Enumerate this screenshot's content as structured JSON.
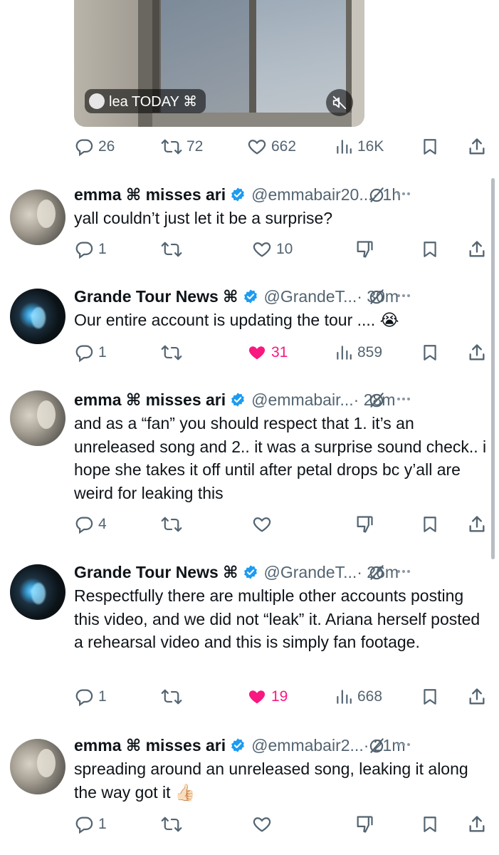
{
  "media": {
    "label": "lea TODAY ⌘"
  },
  "top_actions": {
    "replies": "26",
    "reposts": "72",
    "likes": "662",
    "views": "16K"
  },
  "tweets": [
    {
      "name": "emma ⌘ misses ari",
      "handle": "@emmabair20...",
      "time": "· 1h",
      "text": "yall couldn’t just let it be a surprise?",
      "replies": "1",
      "reposts": "",
      "likes": "10",
      "liked": false,
      "views": ""
    },
    {
      "name": "Grande Tour News ⌘",
      "handle": "@GrandeT...",
      "time": "· 30m",
      "text": "Our entire account is updating the tour .... 😭",
      "replies": "1",
      "reposts": "",
      "likes": "31",
      "liked": true,
      "views": "859"
    },
    {
      "name": "emma ⌘ misses ari",
      "handle": "@emmabair...",
      "time": "· 28m",
      "text": "and as a “fan” you should respect that 1. it’s an unreleased song and 2.. it was a surprise sound check.. i hope she takes it off until after petal drops bc y’all are weird for leaking this",
      "replies": "4",
      "reposts": "",
      "likes": "",
      "liked": false,
      "views": ""
    },
    {
      "name": "Grande Tour News ⌘",
      "handle": "@GrandeT...",
      "time": "· 26m",
      "text": "Respectfully there are multiple other accounts posting this video, and we did not “leak” it. Ariana herself posted a rehearsal video and this is simply fan footage.",
      "replies": "1",
      "reposts": "",
      "likes": "19",
      "liked": true,
      "views": "668"
    },
    {
      "name": "emma ⌘ misses ari",
      "handle": "@emmabair2...",
      "time": "· 21m",
      "text": "spreading around an unreleased song, leaking it along the way got it 👍🏻",
      "replies": "1",
      "reposts": "",
      "likes": "",
      "liked": false,
      "views": ""
    }
  ],
  "colors": {
    "text": "#0f1419",
    "muted": "#536471",
    "like": "#f91880",
    "verified": "#1d9bf0"
  }
}
